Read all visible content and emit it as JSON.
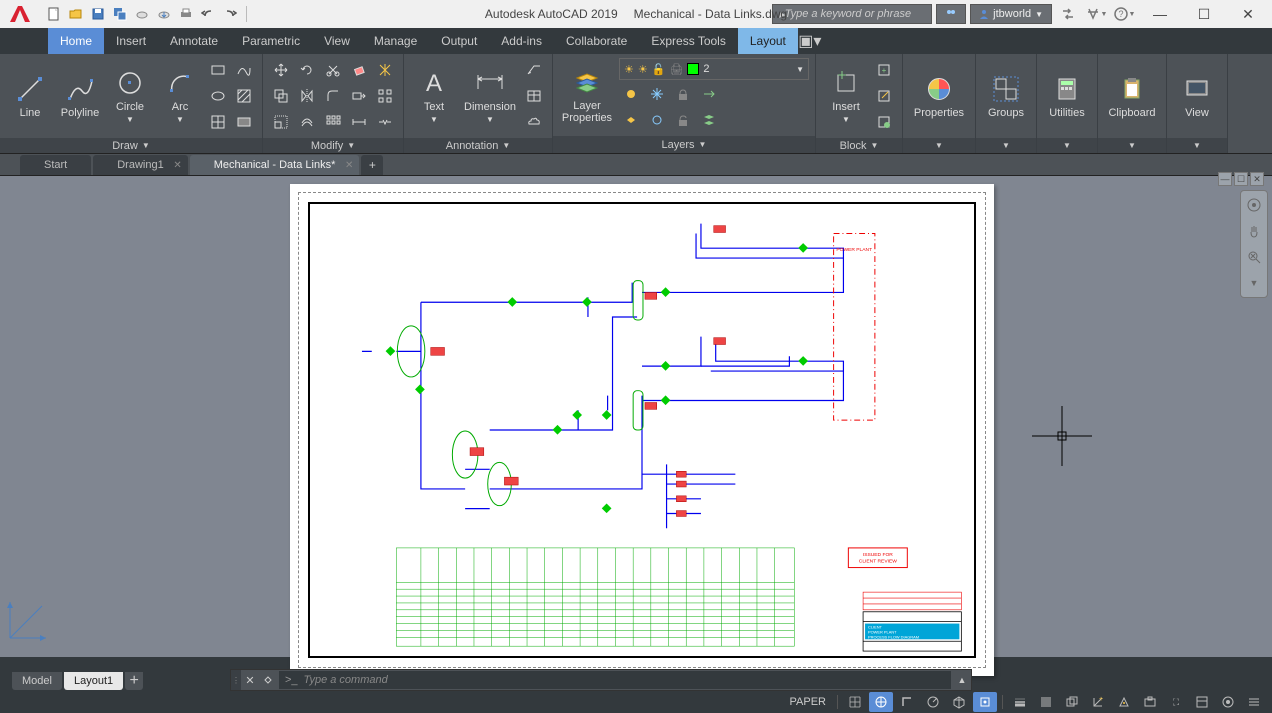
{
  "app": {
    "name": "Autodesk AutoCAD 2019",
    "document": "Mechanical - Data Links.dwg"
  },
  "search": {
    "placeholder": "Type a keyword or phrase"
  },
  "user": {
    "name": "jtbworld"
  },
  "menu": {
    "tabs": [
      "Home",
      "Insert",
      "Annotate",
      "Parametric",
      "View",
      "Manage",
      "Output",
      "Add-ins",
      "Collaborate",
      "Express Tools",
      "Layout"
    ],
    "active": 0,
    "highlight": 10
  },
  "ribbon": {
    "draw": {
      "title": "Draw",
      "line": "Line",
      "polyline": "Polyline",
      "circle": "Circle",
      "arc": "Arc"
    },
    "modify": {
      "title": "Modify"
    },
    "annotation": {
      "title": "Annotation",
      "text": "Text",
      "dimension": "Dimension"
    },
    "layers": {
      "title": "Layers",
      "props": "Layer\nProperties",
      "current": "2"
    },
    "block": {
      "title": "Block",
      "insert": "Insert"
    },
    "properties": {
      "title": "Properties"
    },
    "groups": {
      "title": "Groups"
    },
    "utilities": {
      "title": "Utilities"
    },
    "clipboard": {
      "title": "Clipboard"
    },
    "view": {
      "title": "View"
    }
  },
  "filetabs": {
    "items": [
      {
        "label": "Start",
        "active": false,
        "closable": false
      },
      {
        "label": "Drawing1",
        "active": false,
        "closable": true
      },
      {
        "label": "Mechanical - Data Links*",
        "active": true,
        "closable": true
      }
    ]
  },
  "drawing": {
    "title_block": {
      "client": "CLIENT",
      "project": "POWER PLANT",
      "sheet": "PROCESS FLOW DIAGRAM"
    },
    "stamp": "ISSUED FOR\nCLIENT REVIEW",
    "area_label": "POWER PLANT"
  },
  "command": {
    "placeholder": "Type a command",
    "prompt": ">_"
  },
  "bottomtabs": {
    "items": [
      "Model",
      "Layout1"
    ],
    "active": 1
  },
  "status": {
    "space": "PAPER"
  }
}
